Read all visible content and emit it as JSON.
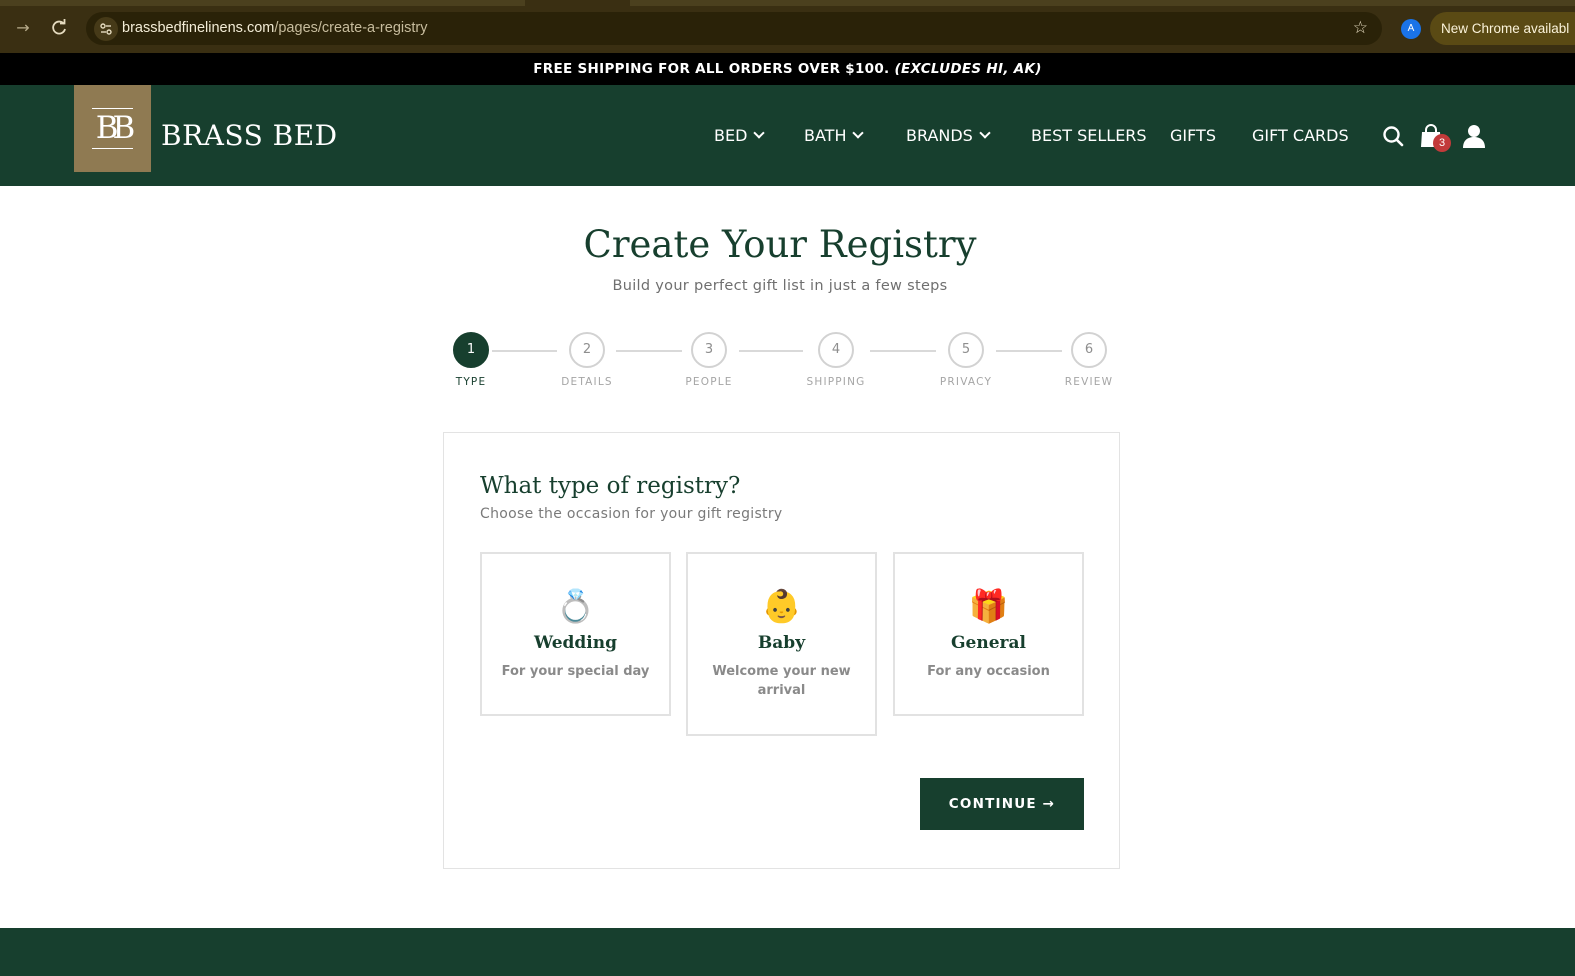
{
  "browser": {
    "url_host": "brassbedfinelinens.com",
    "url_path": "/pages/create-a-registry",
    "profile_initial": "A",
    "update_label": "New Chrome availabl",
    "icons": [
      "forward-arrow-icon",
      "reload-icon",
      "site-settings-icon",
      "star-icon"
    ]
  },
  "announcement": {
    "text": "FREE SHIPPING FOR ALL ORDERS OVER $100.",
    "emphasis": "(EXCLUDES HI, AK)"
  },
  "header": {
    "logo_text": "BRASS BED",
    "logo_monogram": "BB",
    "nav": [
      {
        "label": "BED",
        "dropdown": true
      },
      {
        "label": "BATH",
        "dropdown": true
      },
      {
        "label": "BRANDS",
        "dropdown": true
      },
      {
        "label": "BEST SELLERS",
        "dropdown": false
      },
      {
        "label": "GIFTS",
        "dropdown": false
      },
      {
        "label": "GIFT CARDS",
        "dropdown": false
      }
    ],
    "cart_count": "3"
  },
  "page": {
    "title": "Create Your Registry",
    "subtitle": "Build your perfect gift list in just a few steps"
  },
  "steps": [
    {
      "number": "1",
      "label": "TYPE",
      "active": true
    },
    {
      "number": "2",
      "label": "DETAILS",
      "active": false
    },
    {
      "number": "3",
      "label": "PEOPLE",
      "active": false
    },
    {
      "number": "4",
      "label": "SHIPPING",
      "active": false
    },
    {
      "number": "5",
      "label": "PRIVACY",
      "active": false
    },
    {
      "number": "6",
      "label": "REVIEW",
      "active": false
    }
  ],
  "card": {
    "title": "What type of registry?",
    "subtitle": "Choose the occasion for your gift registry",
    "options": [
      {
        "emoji": "💍",
        "icon": "ring-icon",
        "title": "Wedding",
        "desc": "For your special day"
      },
      {
        "emoji": "👶",
        "icon": "baby-icon",
        "title": "Baby",
        "desc": "Welcome your new arrival"
      },
      {
        "emoji": "🎁",
        "icon": "gift-icon",
        "title": "General",
        "desc": "For any occasion"
      }
    ],
    "continue_label": "CONTINUE →"
  },
  "colors": {
    "brand_green": "#173f2e",
    "logo_gold": "#8f7a52",
    "badge_red": "#c23a3a"
  }
}
